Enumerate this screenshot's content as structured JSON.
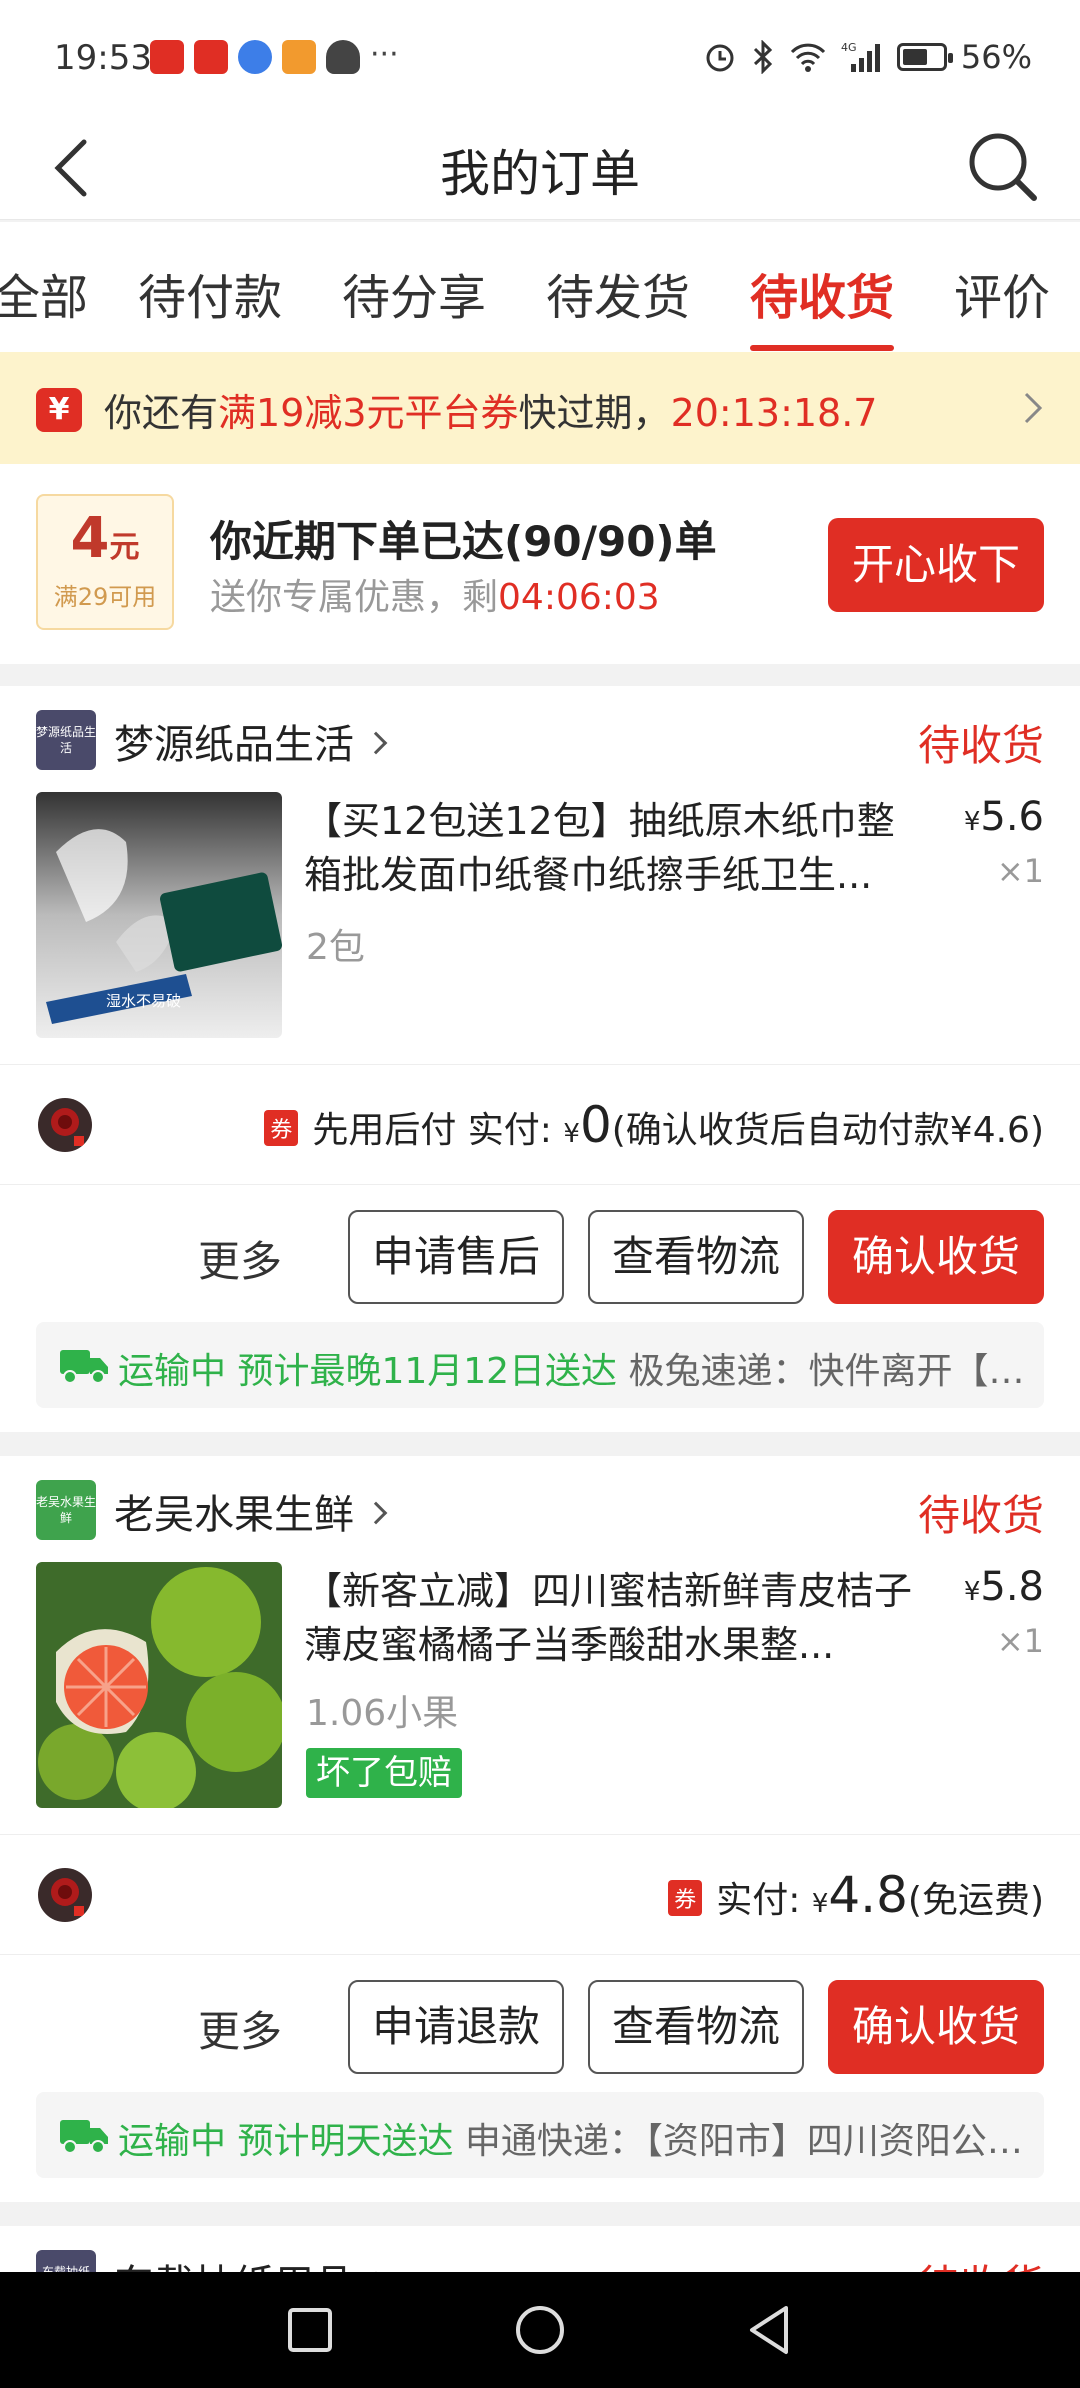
{
  "status_bar": {
    "time": "19:53",
    "battery": "56%",
    "network": "4G"
  },
  "header": {
    "title": "我的订单"
  },
  "tabs": [
    {
      "label": "全部"
    },
    {
      "label": "待付款"
    },
    {
      "label": "待分享"
    },
    {
      "label": "待发货"
    },
    {
      "label": "待收货"
    },
    {
      "label": "评价"
    }
  ],
  "notice": {
    "icon_text": "¥",
    "prefix": "你还有",
    "highlight": "满19减3元平台券",
    "middle": "快过期，",
    "countdown": "20:13:18.7"
  },
  "promo": {
    "amount": "4",
    "unit": "元",
    "condition": "满29可用",
    "title": "你近期下单已达(90/90)单",
    "sub_prefix": "送你专属优惠，剩",
    "sub_countdown": "04:06:03",
    "button": "开心收下"
  },
  "orders": [
    {
      "shop_logo_text": "梦源纸品生活",
      "shop_name": "梦源纸品生活",
      "status": "待收货",
      "title": "【买12包送12包】抽纸原木纸巾整箱批发面巾纸餐巾纸擦手纸卫生...",
      "spec": "2包",
      "price_symbol": "¥",
      "price": "5.6",
      "qty": "×1",
      "thumb_caption": "湿水不易破",
      "pay_label": "先用后付 实付:",
      "pay_yen": "¥",
      "pay_amount": "0",
      "pay_note": "(确认收货后自动付款¥4.6)",
      "buttons": {
        "more": "更多",
        "b1": "申请售后",
        "b2": "查看物流",
        "b3": "确认收货"
      },
      "logistics": {
        "status": "运输中 预计最晚11月12日送达",
        "detail": " 极兔速递：快件离开【中转场】..."
      }
    },
    {
      "shop_logo_text": "老吴水果生鲜",
      "shop_name": "老吴水果生鲜",
      "status": "待收货",
      "title": "【新客立减】四川蜜桔新鲜青皮桔子薄皮蜜橘橘子当季酸甜水果整...",
      "spec": "1.06小果",
      "tag": "坏了包赔",
      "price_symbol": "¥",
      "price": "5.8",
      "qty": "×1",
      "pay_label": "实付:",
      "pay_yen": "¥",
      "pay_amount": "4.8",
      "pay_note": "(免运费)",
      "buttons": {
        "more": "更多",
        "b1": "申请退款",
        "b2": "查看物流",
        "b3": "确认收货"
      },
      "logistics": {
        "status": "运输中 预计明天送达",
        "detail": " 申通快递：【资阳市】四川资阳公司已发出..."
      }
    },
    {
      "shop_logo_text": "东载抽纸",
      "shop_name": "东载抽纸用品",
      "status": "待收货"
    }
  ],
  "coupon_badge": "券",
  "colors": {
    "accent": "#e02e24",
    "green": "#2fb24a",
    "notice_bg": "#fdf3cc"
  }
}
